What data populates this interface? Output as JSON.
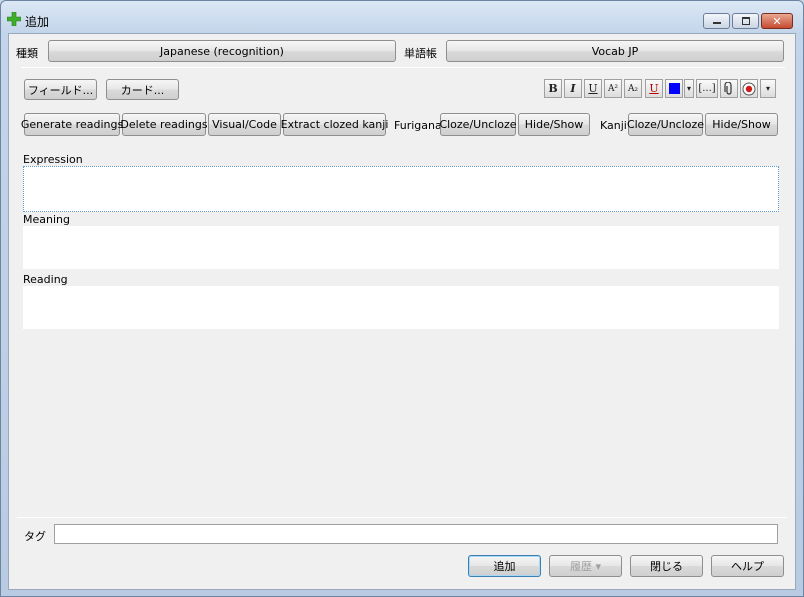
{
  "window": {
    "title": "追加",
    "controls": [
      "minimize-icon",
      "maximize-icon",
      "close-icon"
    ],
    "close_glyph": "✕"
  },
  "note_type": {
    "label": "種類",
    "value": "Japanese (recognition)"
  },
  "deck": {
    "label": "単語帳",
    "value": "Vocab JP"
  },
  "toolbar": {
    "fields_button": "フィールド...",
    "cards_button": "カード...",
    "format_buttons": {
      "bold": "B",
      "italic": "I",
      "underline": "U",
      "superscript": "A²",
      "subscript": "A₂",
      "clear_format": "U",
      "color_dropdown": "▾",
      "cloze": "[...]",
      "more_dropdown": "▾"
    },
    "text_color": "#0000ff"
  },
  "japanese_support": {
    "generate_readings": "Generate readings",
    "delete_readings": "Delete readings",
    "visual_code": "Visual/Code",
    "extract_clozed_kanji": "Extract clozed kanji",
    "furigana_label": "Furigana",
    "furigana_cloze": "Cloze/Uncloze",
    "furigana_hide_show": "Hide/Show",
    "kanji_label": "Kanji",
    "kanji_cloze": "Cloze/Uncloze",
    "kanji_hide_show": "Hide/Show"
  },
  "fields": [
    {
      "name": "Expression",
      "value": ""
    },
    {
      "name": "Meaning",
      "value": ""
    },
    {
      "name": "Reading",
      "value": ""
    }
  ],
  "tags": {
    "label": "タグ",
    "value": ""
  },
  "bottom": {
    "add": "追加",
    "history": "履歴 ▾",
    "close": "閉じる",
    "help": "ヘルプ"
  },
  "colors": {
    "accent": "#3c7fb1",
    "focus_border": "#5f9ad2",
    "record_red": "#d11a1a"
  }
}
